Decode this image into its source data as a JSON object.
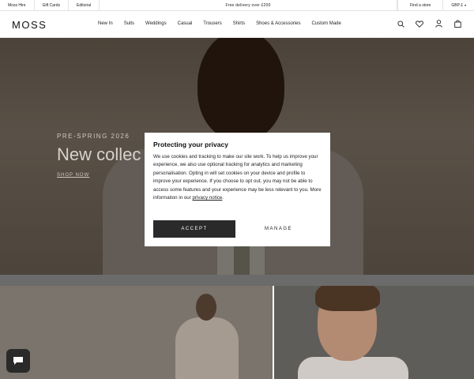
{
  "topbar": {
    "links": [
      "Moss Hire",
      "Gift Cards",
      "Editorial"
    ],
    "promo": "Free delivery over £200",
    "find_store": "Find a store",
    "currency": "GBP £"
  },
  "header": {
    "logo": "MOSS",
    "nav": [
      "New In",
      "Suits",
      "Weddings",
      "Casual",
      "Trousers",
      "Shirts",
      "Shoes & Accessories",
      "Custom Made"
    ],
    "icons": [
      "search-icon",
      "wishlist-heart-icon",
      "account-icon",
      "bag-icon"
    ]
  },
  "hero": {
    "kicker": "PRE-SPRING 2026",
    "headline": "New collec",
    "cta": "SHOP NOW"
  },
  "cookie_dialog": {
    "title": "Protecting your privacy",
    "body": "We use cookies and tracking to make our site work. To help us improve your experience, we also use optional tracking for analytics and marketing personalisation. Opting in will set cookies on your device and profile to improve your experience. If you choose to opt out, you may not be able to access some features and your experience may be less relevant to you. More information in our ",
    "link": "privacy notice",
    "link_suffix": ".",
    "accept": "ACCEPT",
    "manage": "MANAGE"
  },
  "colors": {
    "accent_dark": "#2a2a2a",
    "overlay": "rgba(0,0,0,0.45)"
  }
}
